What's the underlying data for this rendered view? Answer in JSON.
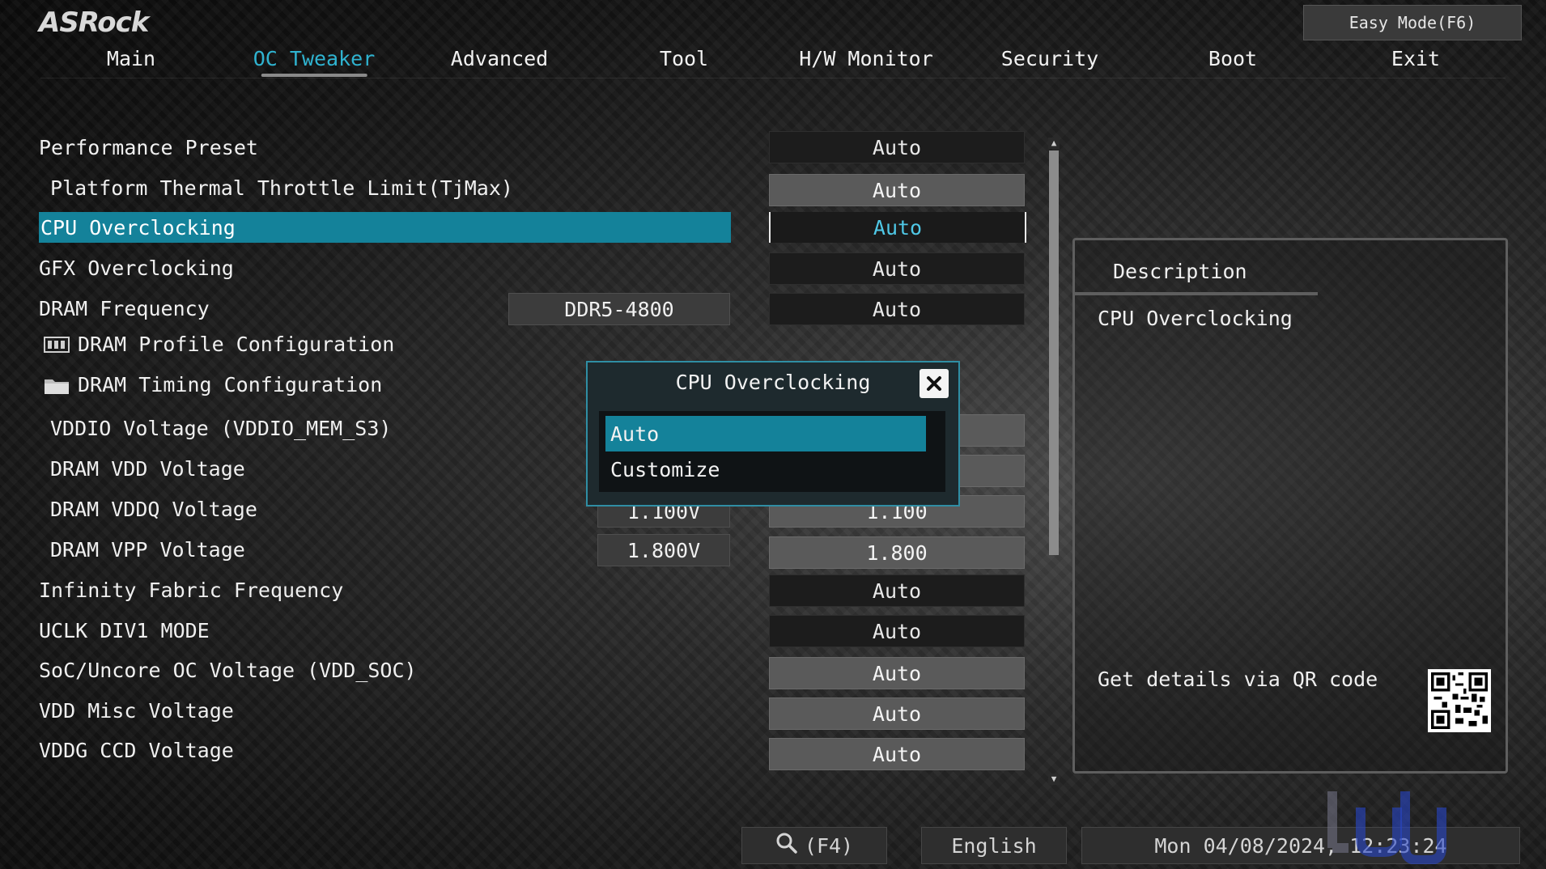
{
  "brand": "ASRock",
  "easy_mode_label": "Easy Mode(F6)",
  "tabs": [
    {
      "label": "Main"
    },
    {
      "label": "OC Tweaker"
    },
    {
      "label": "Advanced"
    },
    {
      "label": "Tool"
    },
    {
      "label": "H/W Monitor"
    },
    {
      "label": "Security"
    },
    {
      "label": "Boot"
    },
    {
      "label": "Exit"
    }
  ],
  "settings": {
    "performance_preset": {
      "label": "Performance Preset",
      "value": "Auto"
    },
    "thermal_throttle": {
      "label": "Platform Thermal Throttle Limit(TjMax)",
      "value": "Auto"
    },
    "cpu_oc": {
      "label": "CPU Overclocking",
      "value": "Auto"
    },
    "gfx_oc": {
      "label": "GFX Overclocking",
      "value": "Auto"
    },
    "dram_freq": {
      "label": "DRAM Frequency",
      "current": "DDR5-4800",
      "value": "Auto"
    },
    "dram_profile": {
      "label": "DRAM Profile Configuration"
    },
    "dram_timing": {
      "label": "DRAM Timing Configuration"
    },
    "vddio": {
      "label": "VDDIO Voltage (VDDIO_MEM_S3)"
    },
    "dram_vdd": {
      "label": "DRAM VDD Voltage"
    },
    "dram_vddq": {
      "label": "DRAM VDDQ Voltage",
      "current": "1.100V",
      "value": "1.100"
    },
    "dram_vpp": {
      "label": "DRAM VPP Voltage",
      "current": "1.800V",
      "value": "1.800"
    },
    "infinity_fabric": {
      "label": "Infinity Fabric Frequency",
      "value": "Auto"
    },
    "uclk": {
      "label": "UCLK DIV1 MODE",
      "value": "Auto"
    },
    "soc_voltage": {
      "label": "SoC/Uncore OC Voltage (VDD_SOC)",
      "value": "Auto"
    },
    "vdd_misc": {
      "label": "VDD Misc Voltage",
      "value": "Auto"
    },
    "vddg_ccd": {
      "label": "VDDG CCD Voltage",
      "value": "Auto"
    }
  },
  "popup": {
    "title": "CPU Overclocking",
    "options": [
      "Auto",
      "Customize"
    ],
    "selected": "Auto"
  },
  "description": {
    "title": "Description",
    "text": "CPU Overclocking",
    "qr_label": "Get details via QR code"
  },
  "bottom": {
    "search_label": "(F4)",
    "language": "English",
    "datetime": "Mon 04/08/2024, 12:23:24"
  },
  "colors": {
    "accent": "#14829a",
    "accent_text": "#2fb3d0"
  }
}
